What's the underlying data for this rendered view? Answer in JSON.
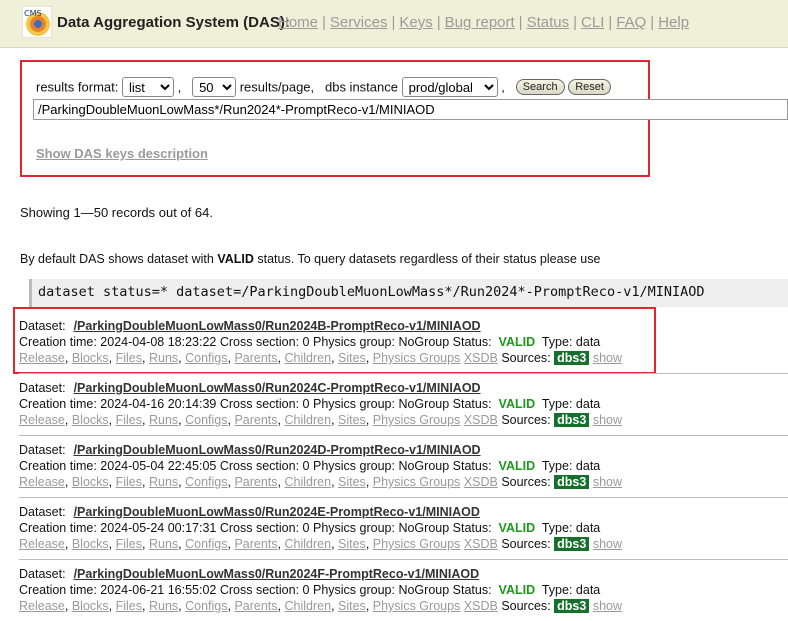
{
  "header": {
    "title": "Data Aggregation System (DAS):",
    "logo_text": "CMS",
    "nav": [
      "Home",
      "Services",
      "Keys",
      "Bug report",
      "Status",
      "CLI",
      "FAQ",
      "Help"
    ]
  },
  "search": {
    "results_format_label": "results format:",
    "results_format_value": "list",
    "per_page_value": "50",
    "per_page_label": "results/page,",
    "dbs_instance_label": "dbs instance",
    "dbs_instance_value": "prod/global",
    "comma": ",",
    "search_button": "Search",
    "reset_button": "Reset",
    "query": "/ParkingDoubleMuonLowMass*/Run2024*-PromptReco-v1/MINIAOD",
    "keys_link": "Show DAS keys description"
  },
  "summary": {
    "showing": "Showing 1—50 records out of 64.",
    "info_prefix": "By default DAS shows dataset with ",
    "info_bold": "VALID",
    "info_suffix": " status. To query datasets regardless of their status please use",
    "code": "dataset status=* dataset=/ParkingDoubleMuonLowMass*/Run2024*-PromptReco-v1/MINIAOD"
  },
  "labels": {
    "dataset": "Dataset:",
    "creation": "Creation time:",
    "cross": "Cross section:",
    "physics": "Physics group:",
    "status": "Status:",
    "type": "Type:",
    "sources": "Sources:",
    "dbs3": "dbs3",
    "show": "show"
  },
  "links": [
    "Release",
    "Blocks",
    "Files",
    "Runs",
    "Configs",
    "Parents",
    "Children",
    "Sites",
    "Physics Groups",
    "XSDB"
  ],
  "records": [
    {
      "dataset": "/ParkingDoubleMuonLowMass0/Run2024B-PromptReco-v1/MINIAOD",
      "time": "2024-04-08 18:23:22",
      "cross": "0",
      "group": "NoGroup",
      "status": "VALID",
      "type": "data"
    },
    {
      "dataset": "/ParkingDoubleMuonLowMass0/Run2024C-PromptReco-v1/MINIAOD",
      "time": "2024-04-16 20:14:39",
      "cross": "0",
      "group": "NoGroup",
      "status": "VALID",
      "type": "data"
    },
    {
      "dataset": "/ParkingDoubleMuonLowMass0/Run2024D-PromptReco-v1/MINIAOD",
      "time": "2024-05-04 22:45:05",
      "cross": "0",
      "group": "NoGroup",
      "status": "VALID",
      "type": "data"
    },
    {
      "dataset": "/ParkingDoubleMuonLowMass0/Run2024E-PromptReco-v1/MINIAOD",
      "time": "2024-05-24 00:17:31",
      "cross": "0",
      "group": "NoGroup",
      "status": "VALID",
      "type": "data"
    },
    {
      "dataset": "/ParkingDoubleMuonLowMass0/Run2024F-PromptReco-v1/MINIAOD",
      "time": "2024-06-21 16:55:02",
      "cross": "0",
      "group": "NoGroup",
      "status": "VALID",
      "type": "data"
    }
  ]
}
